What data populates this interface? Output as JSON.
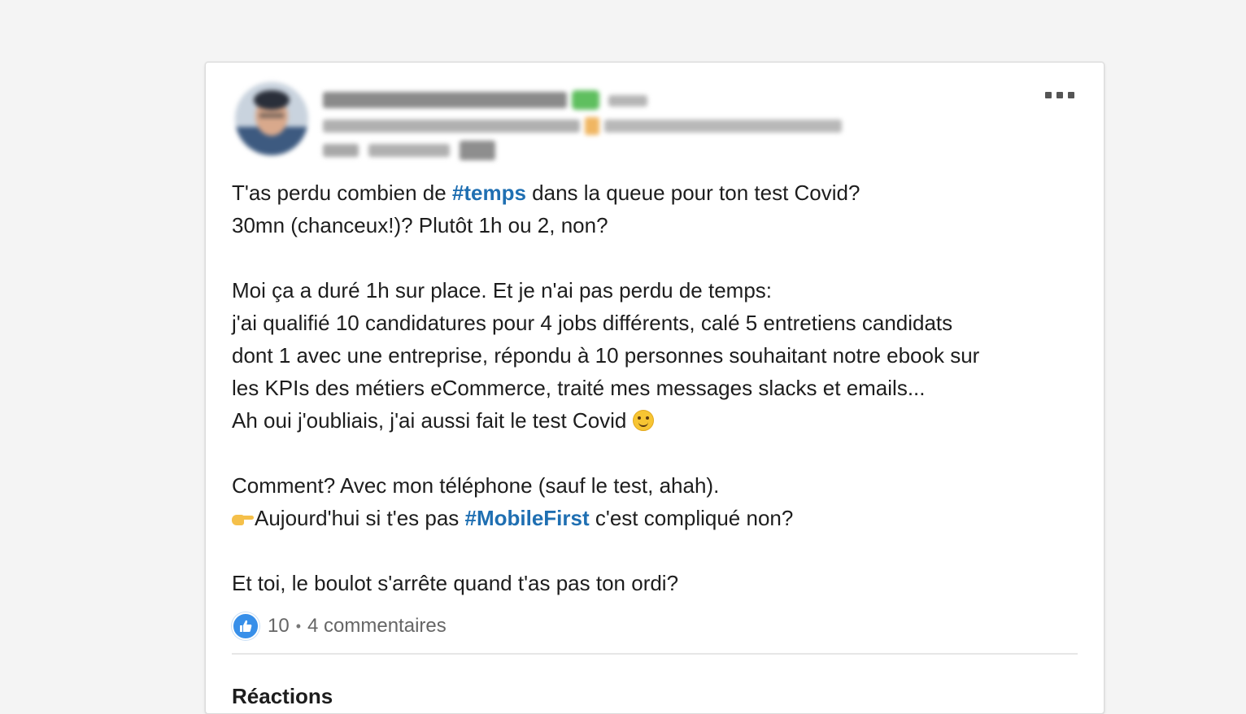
{
  "post": {
    "menu_icon": "more-horizontal-icon",
    "body": {
      "p1_before": "T'as perdu combien de ",
      "tag1": "#temps",
      "p1_after": " dans la queue pour ton test Covid?",
      "p2": "30mn (chanceux!)? Plutôt 1h ou 2, non?",
      "p3": "Moi ça a duré 1h sur place. Et je n'ai pas perdu de temps:",
      "p4": "j'ai qualifié 10 candidatures pour 4 jobs différents, calé 5 entretiens candidats",
      "p5": "dont 1 avec une entreprise, répondu à 10 personnes souhaitant notre ebook sur",
      "p6": "les KPIs des métiers eCommerce, traité mes messages slacks et emails...",
      "p7": "Ah oui j'oubliais, j'ai aussi fait le test Covid ",
      "emoji_smile": "smiling-face-icon",
      "p8": "Comment? Avec mon téléphone (sauf le test, ahah).",
      "emoji_point": "backhand-index-pointing-right-icon",
      "p9_before": "Aujourd'hui si t'es pas ",
      "tag2": "#MobileFirst",
      "p9_after": " c'est compliqué non?",
      "p10": "Et toi, le boulot s'arrête quand t'as pas ton ordi?"
    },
    "social": {
      "like_icon": "thumbs-up-icon",
      "reactions_count": "10",
      "separator": "•",
      "comments": "4 commentaires"
    },
    "reactions_heading": "Réactions"
  },
  "colors": {
    "hashtag": "#1f6fb2",
    "like": "#378fe9",
    "background": "#f4f4f4"
  }
}
